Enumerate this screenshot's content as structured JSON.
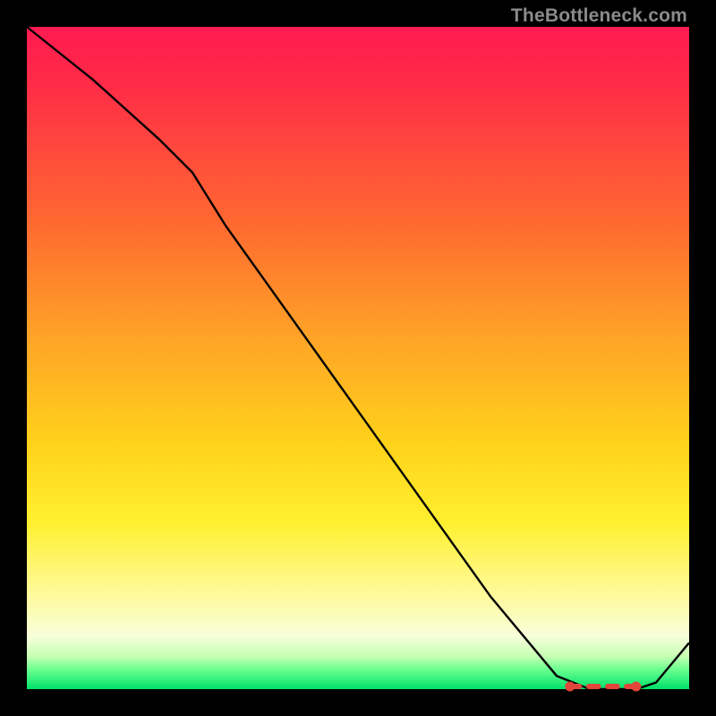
{
  "attribution": "TheBottleneck.com",
  "chart_data": {
    "type": "line",
    "title": "",
    "xlabel": "",
    "ylabel": "",
    "xlim": [
      0,
      100
    ],
    "ylim": [
      0,
      100
    ],
    "series": [
      {
        "name": "curve",
        "x": [
          0,
          10,
          20,
          25,
          30,
          40,
          50,
          60,
          70,
          80,
          85,
          88,
          92,
          95,
          100
        ],
        "values": [
          100,
          92,
          83,
          78,
          70,
          56,
          42,
          28,
          14,
          2,
          0,
          0,
          0,
          1,
          7
        ]
      }
    ],
    "optimal_marker": {
      "x_start": 82,
      "x_end": 92,
      "y": 0
    },
    "gradient_colors": {
      "top": "#ff1a52",
      "mid_upper": "#ffa726",
      "mid": "#fff030",
      "mid_lower": "#f7ffda",
      "bottom": "#00e26a"
    }
  }
}
